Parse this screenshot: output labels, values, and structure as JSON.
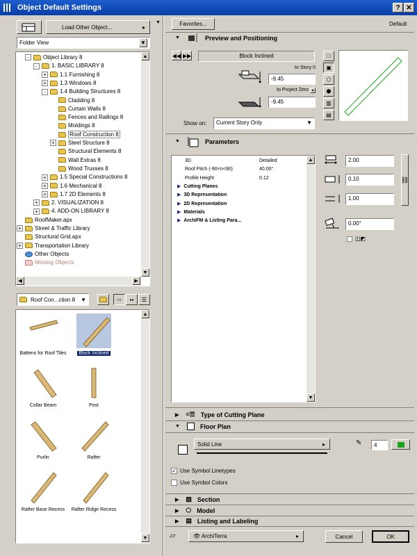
{
  "window": {
    "title": "Object Default Settings",
    "help_label": "?",
    "close_label": "✕"
  },
  "left": {
    "load_other_label": "Load Other Object...",
    "view_select": "Folder View",
    "tree": [
      {
        "label": "Object Library 8",
        "indent": 1,
        "exp": "-",
        "icon": "folder"
      },
      {
        "label": "1. BASIC LIBRARY 8",
        "indent": 2,
        "exp": "-",
        "icon": "folder"
      },
      {
        "label": "1.1 Furnishing 8",
        "indent": 3,
        "exp": "+",
        "icon": "folder"
      },
      {
        "label": "1.3 Windows 8",
        "indent": 3,
        "exp": "+",
        "icon": "folder"
      },
      {
        "label": "1.4 Building Structures 8",
        "indent": 3,
        "exp": "-",
        "icon": "folder"
      },
      {
        "label": "Cladding 8",
        "indent": 4,
        "exp": "",
        "icon": "folder"
      },
      {
        "label": "Curtain Walls 8",
        "indent": 4,
        "exp": "",
        "icon": "folder"
      },
      {
        "label": "Fences and Railings 8",
        "indent": 4,
        "exp": "",
        "icon": "folder"
      },
      {
        "label": "Moldings 8",
        "indent": 4,
        "exp": "",
        "icon": "folder"
      },
      {
        "label": "Roof Construction 8",
        "indent": 4,
        "exp": "",
        "icon": "folder",
        "selected": true
      },
      {
        "label": "Steel Structure 8",
        "indent": 4,
        "exp": "+",
        "icon": "folder"
      },
      {
        "label": "Structural Elements 8",
        "indent": 4,
        "exp": "",
        "icon": "folder"
      },
      {
        "label": "Wall Extras 8",
        "indent": 4,
        "exp": "",
        "icon": "folder"
      },
      {
        "label": "Wood Trusses 8",
        "indent": 4,
        "exp": "",
        "icon": "folder"
      },
      {
        "label": "1.5 Special Constructions 8",
        "indent": 3,
        "exp": "+",
        "icon": "folder"
      },
      {
        "label": "1.6 Mechanical 8",
        "indent": 3,
        "exp": "+",
        "icon": "folder"
      },
      {
        "label": "1.7 2D Elements 8",
        "indent": 3,
        "exp": "+",
        "icon": "folder"
      },
      {
        "label": "2. VISUALIZATION 8",
        "indent": 2,
        "exp": "+",
        "icon": "folder"
      },
      {
        "label": "4. ADD-ON LIBRARY 8",
        "indent": 2,
        "exp": "+",
        "icon": "folder"
      },
      {
        "label": "RoofMaker.apx",
        "indent": 0,
        "exp": "",
        "icon": "folder"
      },
      {
        "label": "Street & Traffic Library",
        "indent": 0,
        "exp": "+",
        "icon": "folder"
      },
      {
        "label": "Structural Grid.apx",
        "indent": 0,
        "exp": "",
        "icon": "folder"
      },
      {
        "label": "Transportation Library",
        "indent": 0,
        "exp": "+",
        "icon": "folder"
      },
      {
        "label": "Other Objects",
        "indent": 0,
        "exp": "",
        "icon": "globe"
      },
      {
        "label": "Missing Objects",
        "indent": 0,
        "exp": "",
        "icon": "missing"
      }
    ],
    "folder_select": "Roof Con...ction 8",
    "thumbs": [
      {
        "label": "Battens for Roof Tiles"
      },
      {
        "label": "Block Inclined",
        "selected": true
      },
      {
        "label": "Collar Beam"
      },
      {
        "label": "Post"
      },
      {
        "label": "Purlin"
      },
      {
        "label": "Rafter"
      },
      {
        "label": "Rafter Base Recess"
      },
      {
        "label": "Rafter Ridge Recess"
      }
    ]
  },
  "right": {
    "favorites_label": "Favorites...",
    "default_label": "Default",
    "preview_title": "Preview and Positioning",
    "object_name": "Block Inclined",
    "to_story_label": "to Story 0",
    "to_story_value": "-9.45",
    "to_project_zero_label": "to Project Zero",
    "to_project_zero_value": "-9.45",
    "show_on_label": "Show on:",
    "show_on_value": "Current Story Only",
    "parameters_title": "Parameters",
    "params": [
      {
        "name": "3D",
        "value": "Detailed",
        "bold": false,
        "arrow": false
      },
      {
        "name": "Roof Pitch (-90<n<90)",
        "value": "40.00°",
        "bold": false,
        "arrow": false
      },
      {
        "name": "Profile Height",
        "value": "0.12",
        "bold": false,
        "arrow": false
      },
      {
        "name": "Cutting Planes",
        "value": "",
        "bold": true,
        "arrow": true
      },
      {
        "name": "3D Representation",
        "value": "",
        "bold": true,
        "arrow": true
      },
      {
        "name": "2D Representation",
        "value": "",
        "bold": true,
        "arrow": true
      },
      {
        "name": "Materials",
        "value": "",
        "bold": true,
        "arrow": true
      },
      {
        "name": "ArchiFM & Listing Para...",
        "value": "",
        "bold": true,
        "arrow": true
      }
    ],
    "dim_a": "2.00",
    "dim_b": "0.10",
    "dim_height": "1.00",
    "angle": "0.00°",
    "cutting_plane_title": "Type of Cutting Plane",
    "floor_plan_title": "Floor Plan",
    "line_type": "Solid Line",
    "pen_number": "4",
    "use_symbol_linetypes": "Use Symbol Linetypes",
    "use_symbol_colors": "Use Symbol Colors",
    "section_title": "Section",
    "model_title": "Model",
    "listing_title": "Listing and Labeling",
    "layer_value": "ArchiTerra",
    "cancel_label": "Cancel",
    "ok_label": "OK"
  },
  "colors": {
    "titlebar": "#0a3fa8",
    "selection": "#0a246a",
    "pen_color": "#1aa31a"
  }
}
